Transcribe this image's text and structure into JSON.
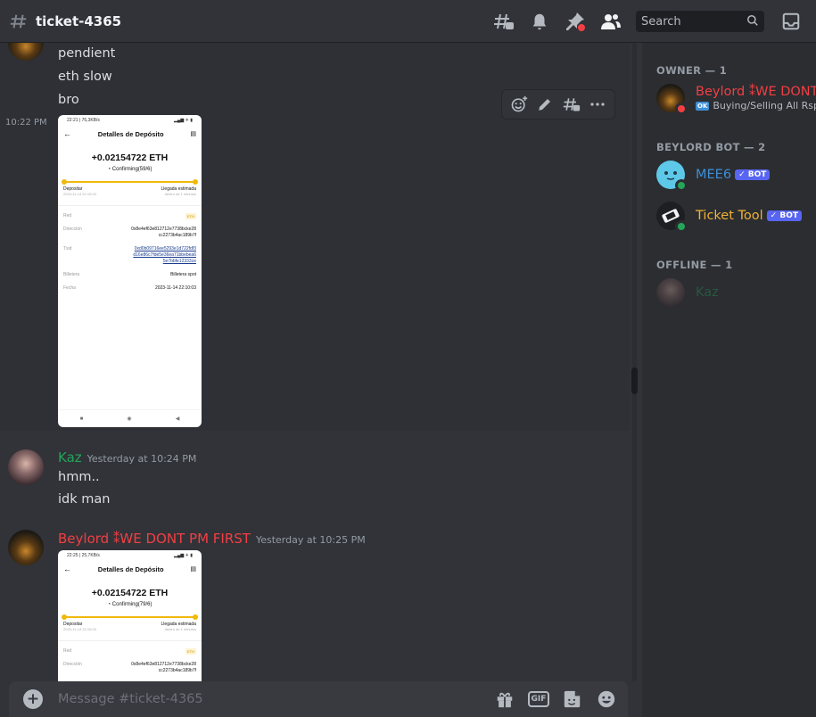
{
  "header": {
    "channel_name": "ticket-4365",
    "search_placeholder": "Search"
  },
  "messages": [
    {
      "type": "continuation",
      "lines": [
        "pendient",
        "eth slow",
        "bro"
      ]
    },
    {
      "type": "image",
      "side_time": "10:22 PM"
    },
    {
      "type": "group",
      "author": "Kaz",
      "author_color": "#23a55a",
      "timestamp": "Yesterday at 10:24 PM",
      "lines": [
        "hmm..",
        "idk man"
      ]
    },
    {
      "type": "group",
      "author": "Beylord ⁑WE DONT PM FIRST",
      "author_color": "#f23f43",
      "timestamp": "Yesterday at 10:25 PM"
    }
  ],
  "screenshot1": {
    "status_bar_time": "22:21 | 76,3KB/s",
    "title": "Detalles de Depósito",
    "amount": "+0.02154722 ETH",
    "confirming": "Confirming(59/6)",
    "left_label": "Depositar",
    "left_date": "2023-11-14 22:10:03",
    "right_label": "Llegada estimada",
    "right_sub": "dentro de 1 minutos",
    "rows": [
      {
        "k": "Red",
        "v": "ETH"
      },
      {
        "k": "Dirección",
        "v": "0x8e4ef63e812712e7738bcke28 cc2273b4ac189b7f"
      },
      {
        "k": "Txid",
        "v": "0xd0b09716ee5293e1d722fdf3 d16e86c7fde5e36ea71bbebea6 5e7bbfe12333ce"
      },
      {
        "k": "Billetera",
        "v": "Billetera spot"
      },
      {
        "k": "Fecha",
        "v": "2023-11-14 22:10:03"
      }
    ]
  },
  "screenshot2": {
    "status_bar_time": "22:25 | 25,7KB/s",
    "title": "Detalles de Depósito",
    "amount": "+0.02154722 ETH",
    "confirming": "Confirming(79/6)",
    "left_label": "Depositar",
    "left_date": "2023-11-14 22:10:03",
    "right_label": "Llegada estimada",
    "right_sub": "dentro de 1 minutos",
    "rows": [
      {
        "k": "Red",
        "v": "ETH"
      },
      {
        "k": "Dirección",
        "v": "0x8e4ef63e812712e7738bcke28 cc2273b4ac189b7f"
      }
    ]
  },
  "composer": {
    "placeholder": "Message #ticket-4365",
    "gif_label": "GIF"
  },
  "members": {
    "owner_header": "OWNER — 1",
    "owner": {
      "name": "Beylord ⁑WE DONT",
      "color": "#f23f43",
      "status_badge": "OK",
      "status_text": "Buying/Selling All Rsps"
    },
    "bot_header": "BEYLORD BOT — 2",
    "bots": [
      {
        "name": "MEE6",
        "color": "#3e8fd6",
        "badge": "✓ BOT"
      },
      {
        "name": "Ticket Tool",
        "color": "#f0b232",
        "badge": "✓ BOT"
      }
    ],
    "offline_header": "OFFLINE — 1",
    "offline": [
      {
        "name": "Kaz",
        "color": "#23a55a"
      }
    ]
  }
}
